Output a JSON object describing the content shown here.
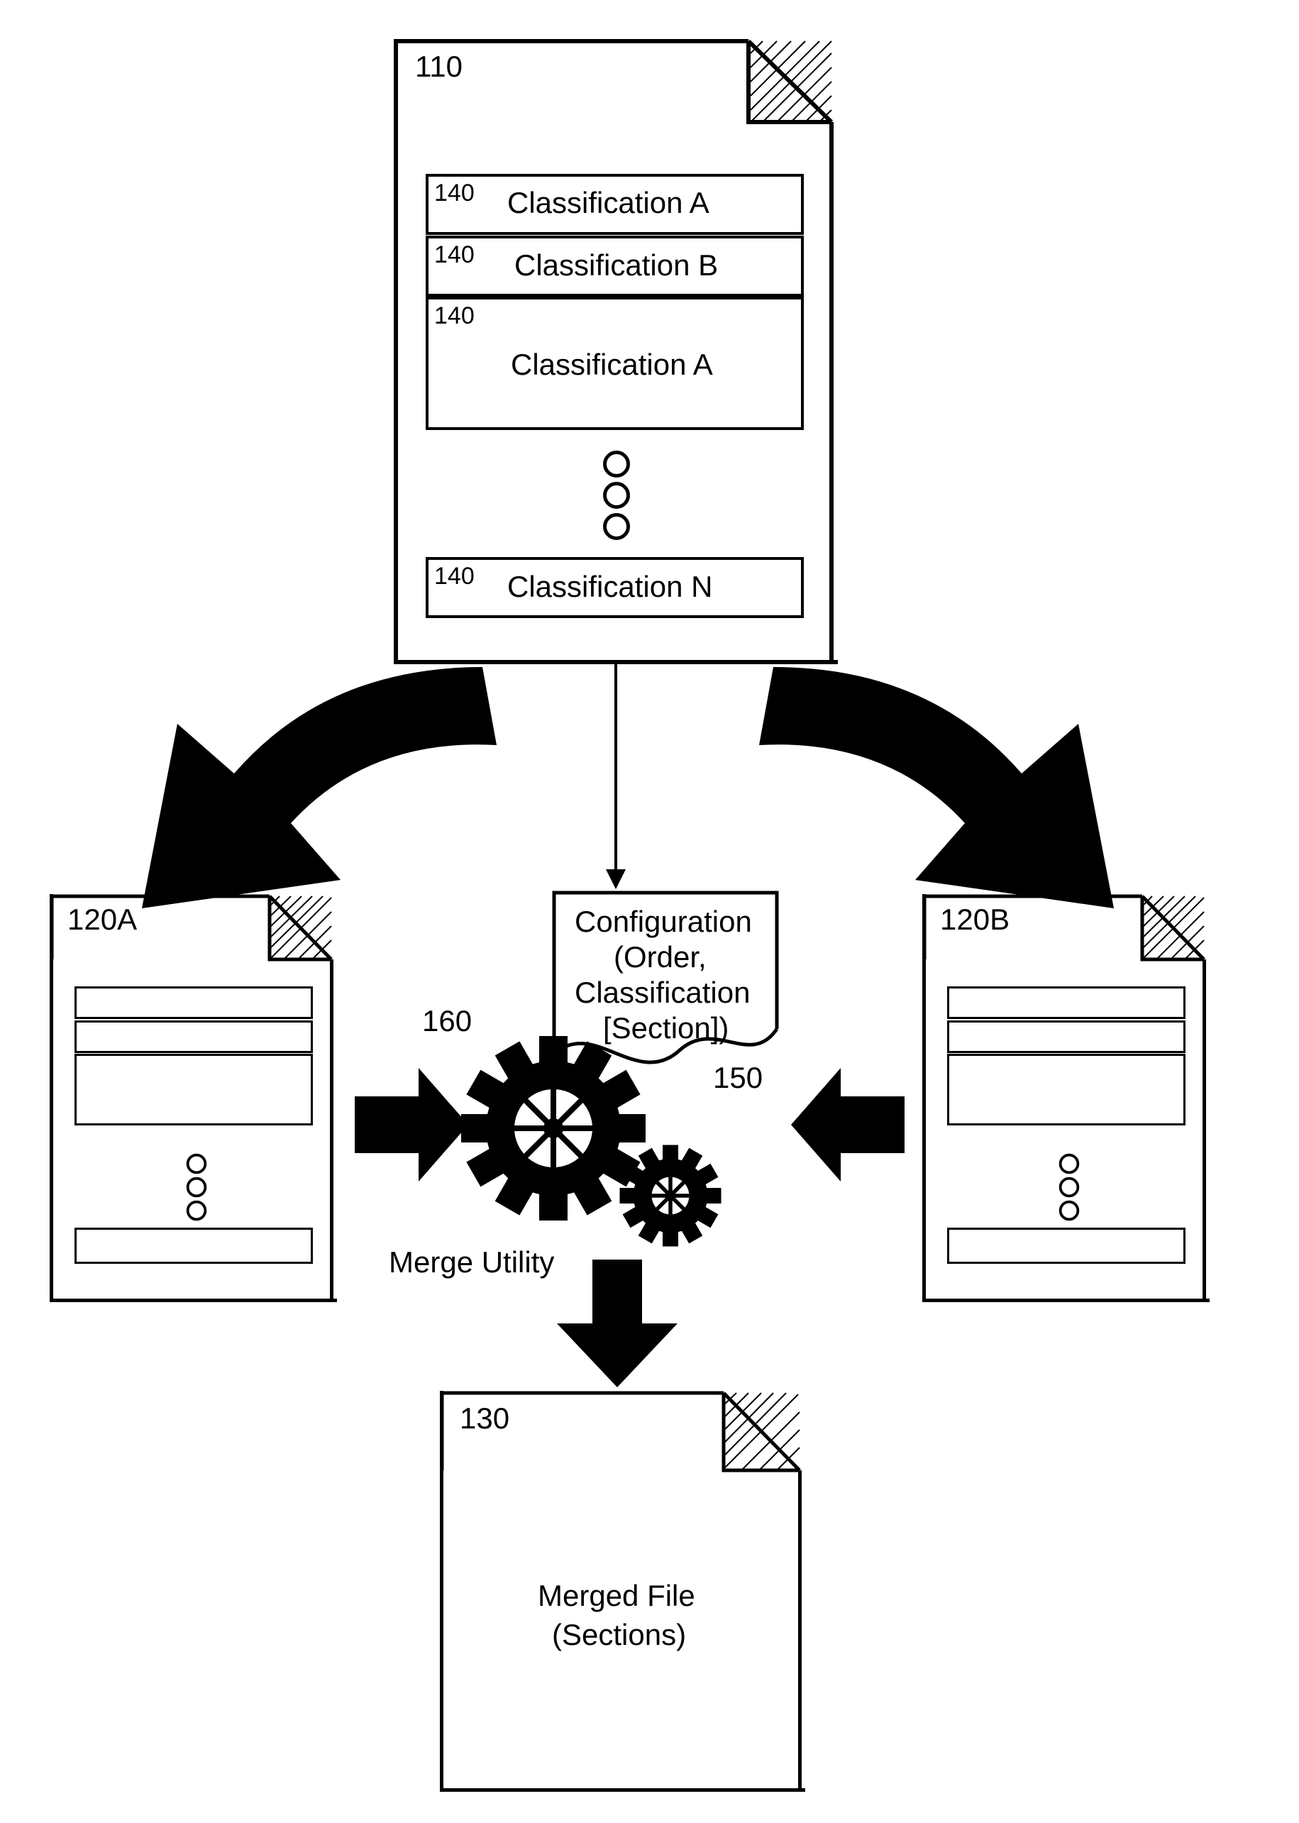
{
  "refs": {
    "source_doc": "110",
    "section_ref": "140",
    "left_doc": "120A",
    "right_doc": "120B",
    "merged_doc": "130",
    "config_ref": "150",
    "gear_ref": "160"
  },
  "source": {
    "sections": {
      "a1": "Classification A",
      "b": "Classification B",
      "a2": "Classification A",
      "n": "Classification N"
    }
  },
  "config": {
    "l1": "Configuration",
    "l2": "(Order,",
    "l3": "Classification",
    "l4": "[Section])"
  },
  "merge_utility_label": "Merge Utility",
  "merged": {
    "l1": "Merged File",
    "l2": "(Sections)"
  }
}
